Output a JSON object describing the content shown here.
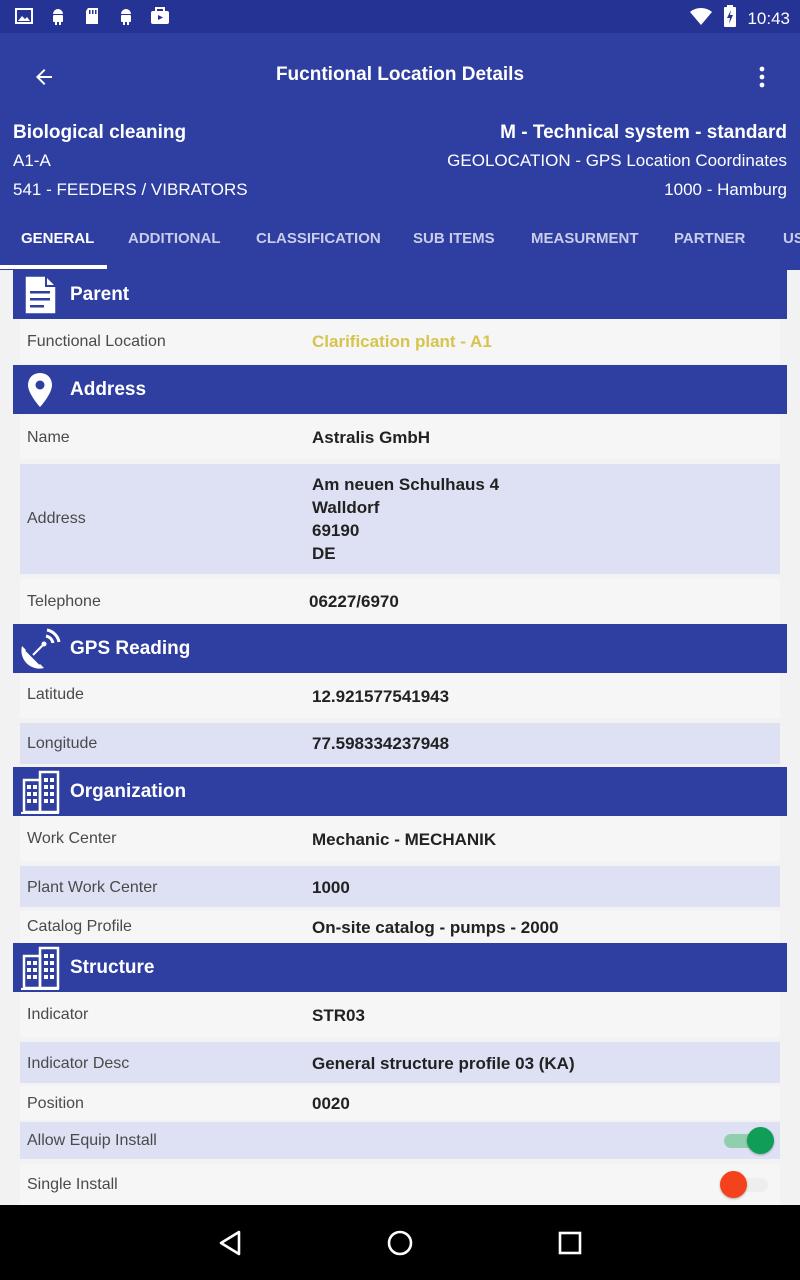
{
  "status_bar": {
    "time": "10:43",
    "left_icons": [
      "image-icon",
      "android-icon",
      "sd-card-icon",
      "android-icon",
      "media-store-icon"
    ],
    "right_icons": [
      "wifi-icon",
      "battery-charging-icon"
    ]
  },
  "toolbar": {
    "title": "Fucntional Location Details",
    "back_icon": "arrow-back-icon",
    "menu_icon": "more-vert-icon"
  },
  "header": {
    "left": [
      "Biological cleaning",
      "A1-A",
      "541 - FEEDERS / VIBRATORS"
    ],
    "right": [
      "M - Technical system - standard",
      "GEOLOCATION - GPS Location Coordinates",
      "1000 - Hamburg"
    ]
  },
  "tabs": [
    {
      "label": "GENERAL",
      "active": true
    },
    {
      "label": "ADDITIONAL",
      "active": false
    },
    {
      "label": "CLASSIFICATION",
      "active": false
    },
    {
      "label": "SUB ITEMS",
      "active": false
    },
    {
      "label": "MEASURMENT",
      "active": false
    },
    {
      "label": "PARTNER",
      "active": false
    },
    {
      "label": "US",
      "active": false
    }
  ],
  "sections": {
    "parent": {
      "title": "Parent",
      "icon": "document-icon",
      "rows": [
        {
          "label": "Functional Location",
          "value": "Clarification plant - A1"
        }
      ]
    },
    "address": {
      "title": "Address",
      "icon": "location-pin-icon",
      "rows": [
        {
          "label": "Name",
          "value": "Astralis GmbH"
        },
        {
          "label": "Address",
          "lines": [
            "Am neuen Schulhaus 4",
            "Walldorf",
            "69190",
            "DE"
          ]
        },
        {
          "label": "Telephone",
          "value": "06227/6970"
        }
      ]
    },
    "gps": {
      "title": "GPS Reading",
      "icon": "satellite-dish-icon",
      "rows": [
        {
          "label": "Latitude",
          "value": "12.921577541943"
        },
        {
          "label": "Longitude",
          "value": "77.598334237948"
        }
      ]
    },
    "organization": {
      "title": "Organization",
      "icon": "building-icon",
      "rows": [
        {
          "label": "Work Center",
          "value": "Mechanic - MECHANIK"
        },
        {
          "label": "Plant Work Center",
          "value": "1000"
        },
        {
          "label": "Catalog Profile",
          "value": "On-site catalog - pumps - 2000"
        }
      ]
    },
    "structure": {
      "title": "Structure",
      "icon": "building-icon",
      "rows": [
        {
          "label": "Indicator",
          "value": "STR03"
        },
        {
          "label": "Indicator Desc",
          "value": "General structure profile 03 (KA)"
        },
        {
          "label": "Position",
          "value": "0020"
        },
        {
          "label": "Allow Equip Install",
          "toggle": true,
          "color": "#0f9d58"
        },
        {
          "label": "Single Install",
          "toggle": false,
          "color": "#f4421c"
        }
      ]
    }
  },
  "navbar": {
    "icons": [
      "nav-back-icon",
      "nav-home-icon",
      "nav-recents-icon"
    ]
  }
}
